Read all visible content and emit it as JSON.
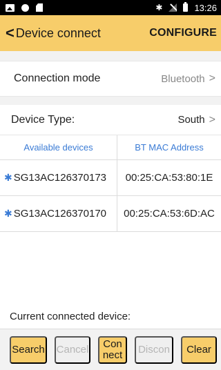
{
  "status_bar": {
    "icons": [
      "image-icon",
      "circle-icon",
      "sd-card-icon",
      "bluetooth-icon",
      "no-signal-icon",
      "battery-icon"
    ],
    "bluetooth_glyph": "✱",
    "time": "13:26"
  },
  "app_bar": {
    "back_glyph": "<",
    "title": "Device connect",
    "action": "CONFIGURE"
  },
  "connection_mode": {
    "label": "Connection mode",
    "value": "Bluetooth",
    "arrow": ">"
  },
  "device_type": {
    "label": "Device Type:",
    "value": "South",
    "arrow": ">"
  },
  "devices_table": {
    "headers": [
      "Available devices",
      "BT MAC Address"
    ],
    "bt_glyph": "✱",
    "rows": [
      {
        "name": "SG13AC126370173",
        "mac": "00:25:CA:53:80:1E"
      },
      {
        "name": "SG13AC126370170",
        "mac": "00:25:CA:53:6D:AC"
      }
    ]
  },
  "current_device": {
    "label": "Current connected device:"
  },
  "buttons": {
    "search": "Search",
    "cancel": "Cancel",
    "connect": "Connect",
    "discon": "Discon",
    "clear": "Clear"
  },
  "colors": {
    "accent": "#f7cd6a",
    "link_blue": "#3a7bd5",
    "disabled_text": "#b5b5b5"
  }
}
